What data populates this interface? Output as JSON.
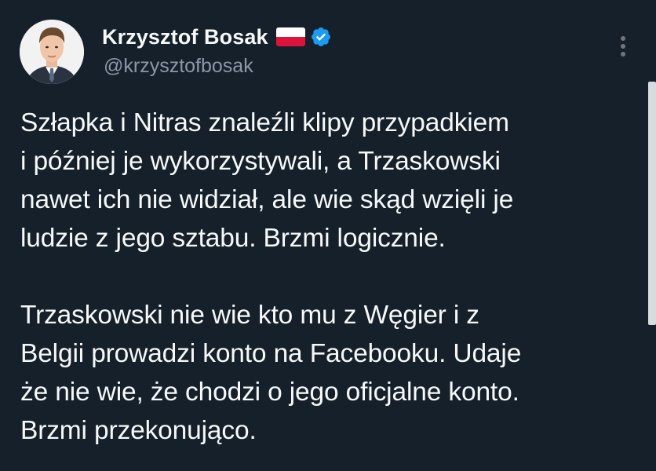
{
  "author": {
    "display_name": "Krzysztof Bosak",
    "handle": "@krzysztofbosak",
    "flag_icon": "poland-flag-icon",
    "verified_icon": "verified-badge-icon",
    "verified_color": "#1d9bf0"
  },
  "tweet": {
    "paragraphs": [
      "Szłapka i Nitras znaleźli klipy przypadkiem\ni później je wykorzystywali, a Trzaskowski\nnawet ich nie widział, ale wie skąd wzięli je\nludzie z jego sztabu. Brzmi logicznie.",
      "Trzaskowski nie wie kto mu z Węgier i z\nBelgii prowadzi konto na Facebooku. Udaje\nże nie wie, że chodzi o jego oficjalne konto.\nBrzmi przekonująco."
    ]
  },
  "theme": {
    "background": "#15202b",
    "text": "#f7f9f9",
    "secondary_text": "#8b98a5"
  }
}
